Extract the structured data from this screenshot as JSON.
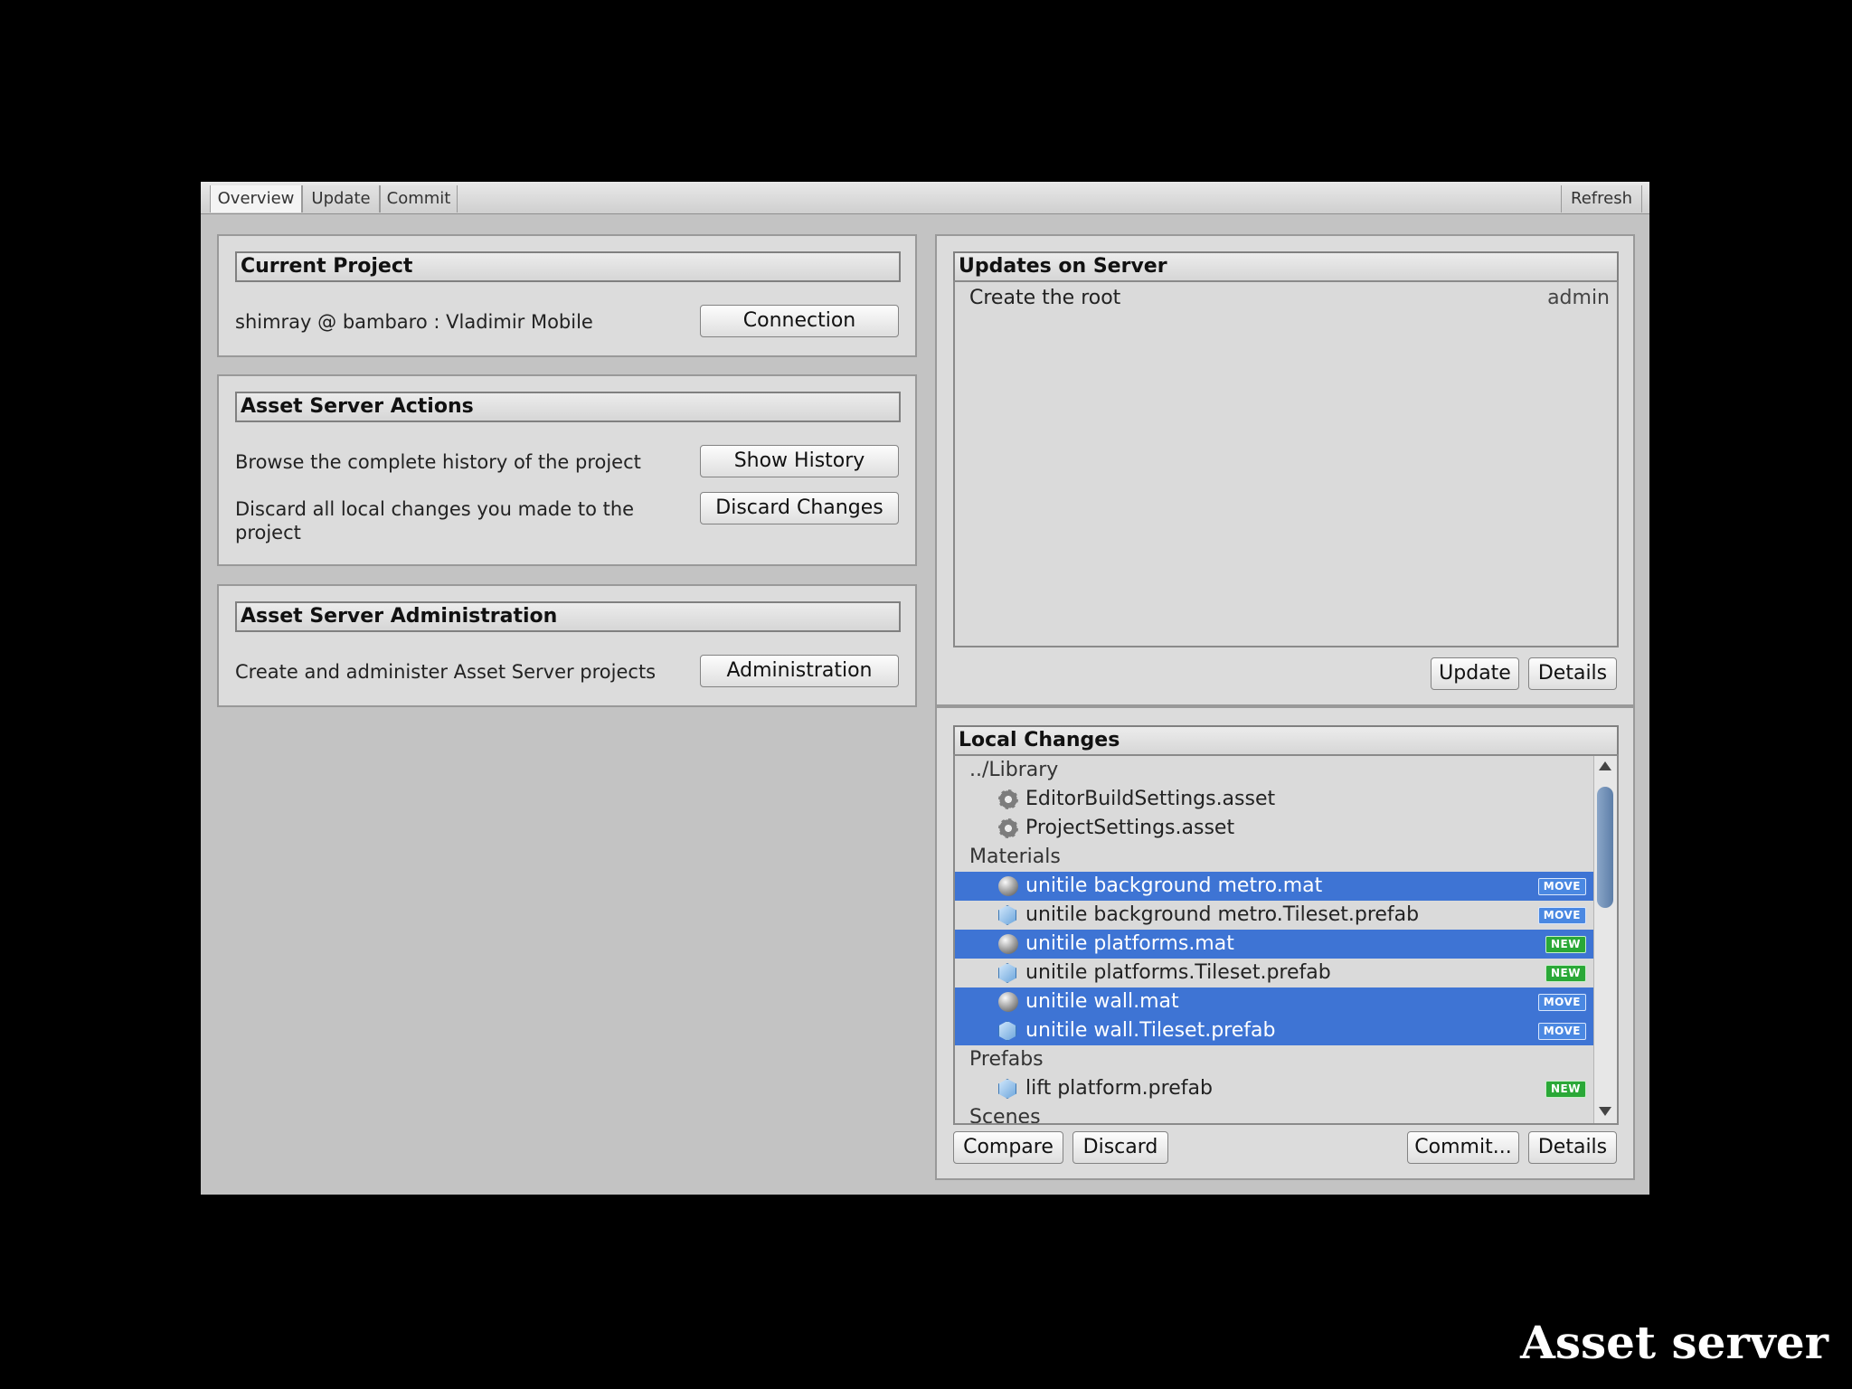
{
  "tabs": {
    "overview": "Overview",
    "update": "Update",
    "commit": "Commit",
    "refresh": "Refresh"
  },
  "current_project": {
    "title": "Current Project",
    "connection_info": "shimray @ bambaro : Vladimir Mobile",
    "connection_button": "Connection"
  },
  "actions": {
    "title": "Asset Server Actions",
    "history_text": "Browse the complete history of the project",
    "history_button": "Show History",
    "discard_text": "Discard all local changes you made to the project",
    "discard_button": "Discard Changes"
  },
  "administration": {
    "title": "Asset Server Administration",
    "text": "Create and administer Asset Server projects",
    "button": "Administration"
  },
  "updates_on_server": {
    "title": "Updates on Server",
    "items": [
      {
        "message": "Create the root",
        "author": "admin"
      }
    ],
    "update_button": "Update",
    "details_button": "Details"
  },
  "local_changes": {
    "title": "Local Changes",
    "rows": [
      {
        "label": "../Library"
      },
      {
        "label": "EditorBuildSettings.asset",
        "icon": "gear-icon"
      },
      {
        "label": "ProjectSettings.asset",
        "icon": "gear-icon"
      },
      {
        "label": "Materials"
      },
      {
        "label": "unitile background metro.mat",
        "icon": "material-sphere-icon",
        "badge": "MOVE",
        "selected": true
      },
      {
        "label": "unitile background metro.Tileset.prefab",
        "icon": "prefab-cube-icon",
        "badge": "MOVE",
        "selected": false
      },
      {
        "label": "unitile platforms.mat",
        "icon": "material-sphere-icon",
        "badge": "NEW",
        "selected": true
      },
      {
        "label": "unitile platforms.Tileset.prefab",
        "icon": "prefab-cube-icon",
        "badge": "NEW",
        "selected": false
      },
      {
        "label": "unitile wall.mat",
        "icon": "material-sphere-icon",
        "badge": "MOVE",
        "selected": true
      },
      {
        "label": "unitile wall.Tileset.prefab",
        "icon": "prefab-cube-icon",
        "badge": "MOVE",
        "selected": true
      },
      {
        "label": "Prefabs"
      },
      {
        "label": "lift platform.prefab",
        "icon": "prefab-cube-icon",
        "badge": "NEW",
        "selected": false
      },
      {
        "label": "Scenes"
      }
    ],
    "compare_button": "Compare",
    "discard_button": "Discard",
    "commit_button": "Commit...",
    "details_button": "Details"
  },
  "colors": {
    "selection": "#3e74d4",
    "move_badge": "#4a88e2",
    "new_badge": "#2aa837"
  },
  "caption": "Asset server"
}
